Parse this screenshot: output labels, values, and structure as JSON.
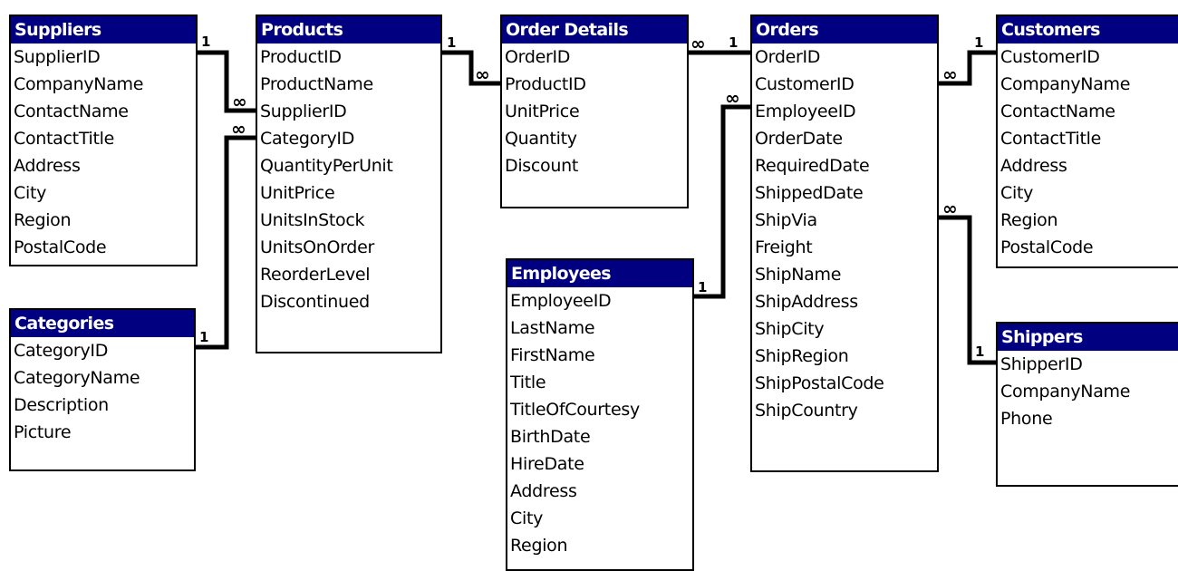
{
  "tables": {
    "suppliers": {
      "title": "Suppliers",
      "fields": [
        "SupplierID",
        "CompanyName",
        "ContactName",
        "ContactTitle",
        "Address",
        "City",
        "Region",
        "PostalCode"
      ]
    },
    "categories": {
      "title": "Categories",
      "fields": [
        "CategoryID",
        "CategoryName",
        "Description",
        "Picture"
      ]
    },
    "products": {
      "title": "Products",
      "fields": [
        "ProductID",
        "ProductName",
        "SupplierID",
        "CategoryID",
        "QuantityPerUnit",
        "UnitPrice",
        "UnitsInStock",
        "UnitsOnOrder",
        "ReorderLevel",
        "Discontinued"
      ]
    },
    "order_details": {
      "title": "Order Details",
      "fields": [
        "OrderID",
        "ProductID",
        "UnitPrice",
        "Quantity",
        "Discount"
      ]
    },
    "employees": {
      "title": "Employees",
      "fields": [
        "EmployeeID",
        "LastName",
        "FirstName",
        "Title",
        "TitleOfCourtesy",
        "BirthDate",
        "HireDate",
        "Address",
        "City",
        "Region"
      ]
    },
    "orders": {
      "title": "Orders",
      "fields": [
        "OrderID",
        "CustomerID",
        "EmployeeID",
        "OrderDate",
        "RequiredDate",
        "ShippedDate",
        "ShipVia",
        "Freight",
        "ShipName",
        "ShipAddress",
        "ShipCity",
        "ShipRegion",
        "ShipPostalCode",
        "ShipCountry"
      ]
    },
    "customers": {
      "title": "Customers",
      "fields": [
        "CustomerID",
        "CompanyName",
        "ContactName",
        "ContactTitle",
        "Address",
        "City",
        "Region",
        "PostalCode"
      ]
    },
    "shippers": {
      "title": "Shippers",
      "fields": [
        "ShipperID",
        "CompanyName",
        "Phone"
      ]
    }
  },
  "cardinality": {
    "one": "1",
    "many": "∞"
  }
}
